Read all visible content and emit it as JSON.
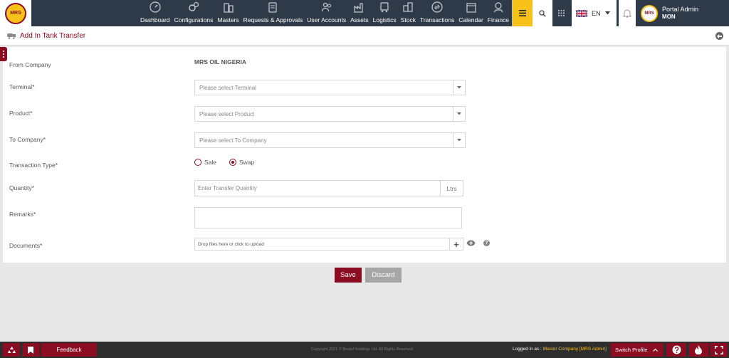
{
  "brand": {
    "logo_text": "MRS"
  },
  "nav": {
    "items": [
      {
        "label": "Dashboard",
        "icon": "speedometer-icon"
      },
      {
        "label": "Configurations",
        "icon": "gears-icon"
      },
      {
        "label": "Masters",
        "icon": "buildings-icon"
      },
      {
        "label": "Requests & Approvals",
        "icon": "clipboard-icon"
      },
      {
        "label": "User Accounts",
        "icon": "users-icon"
      },
      {
        "label": "Assets",
        "icon": "factory-icon"
      },
      {
        "label": "Logistics",
        "icon": "truck-icon"
      },
      {
        "label": "Stock",
        "icon": "boxes-icon"
      },
      {
        "label": "Transactions",
        "icon": "exchange-icon"
      },
      {
        "label": "Calendar",
        "icon": "calendar-icon"
      },
      {
        "label": "Finance",
        "icon": "money-hand-icon"
      }
    ],
    "language": "EN",
    "user": {
      "name": "Portal Admin",
      "code": "MON"
    }
  },
  "page": {
    "title": "Add In Tank Transfer"
  },
  "form": {
    "from_company": {
      "label": "From Company",
      "value": "MRS OIL NIGERIA"
    },
    "terminal": {
      "label": "Terminal*",
      "placeholder": "Please select Terminal"
    },
    "product": {
      "label": "Product*",
      "placeholder": "Please select Product"
    },
    "to_company": {
      "label": "To Company*",
      "placeholder": "Please select To Company"
    },
    "transaction_type": {
      "label": "Transaction Type*",
      "options": [
        "Sale",
        "Swap"
      ],
      "selected": "Swap"
    },
    "quantity": {
      "label": "Quantity*",
      "placeholder": "Enter Transfer Quantity",
      "unit": "Ltrs"
    },
    "remarks": {
      "label": "Remarks*"
    },
    "documents": {
      "label": "Documents*",
      "placeholder": "Drop files here or click to upload",
      "help": "?"
    },
    "save_label": "Save",
    "discard_label": "Discard"
  },
  "footer": {
    "feedback": "Feedback",
    "copyright": "Copyright 2021 © Bestaf Holdings Ltd. All Rights Reserved",
    "logged_in_as": "Logged in as :",
    "company": "Master Company [MRS Admin]",
    "switch_profile": "Switch Profile"
  },
  "colors": {
    "brand": "#8b0d22",
    "nav_bg": "#2f3a48",
    "accent": "#f6c21a"
  }
}
